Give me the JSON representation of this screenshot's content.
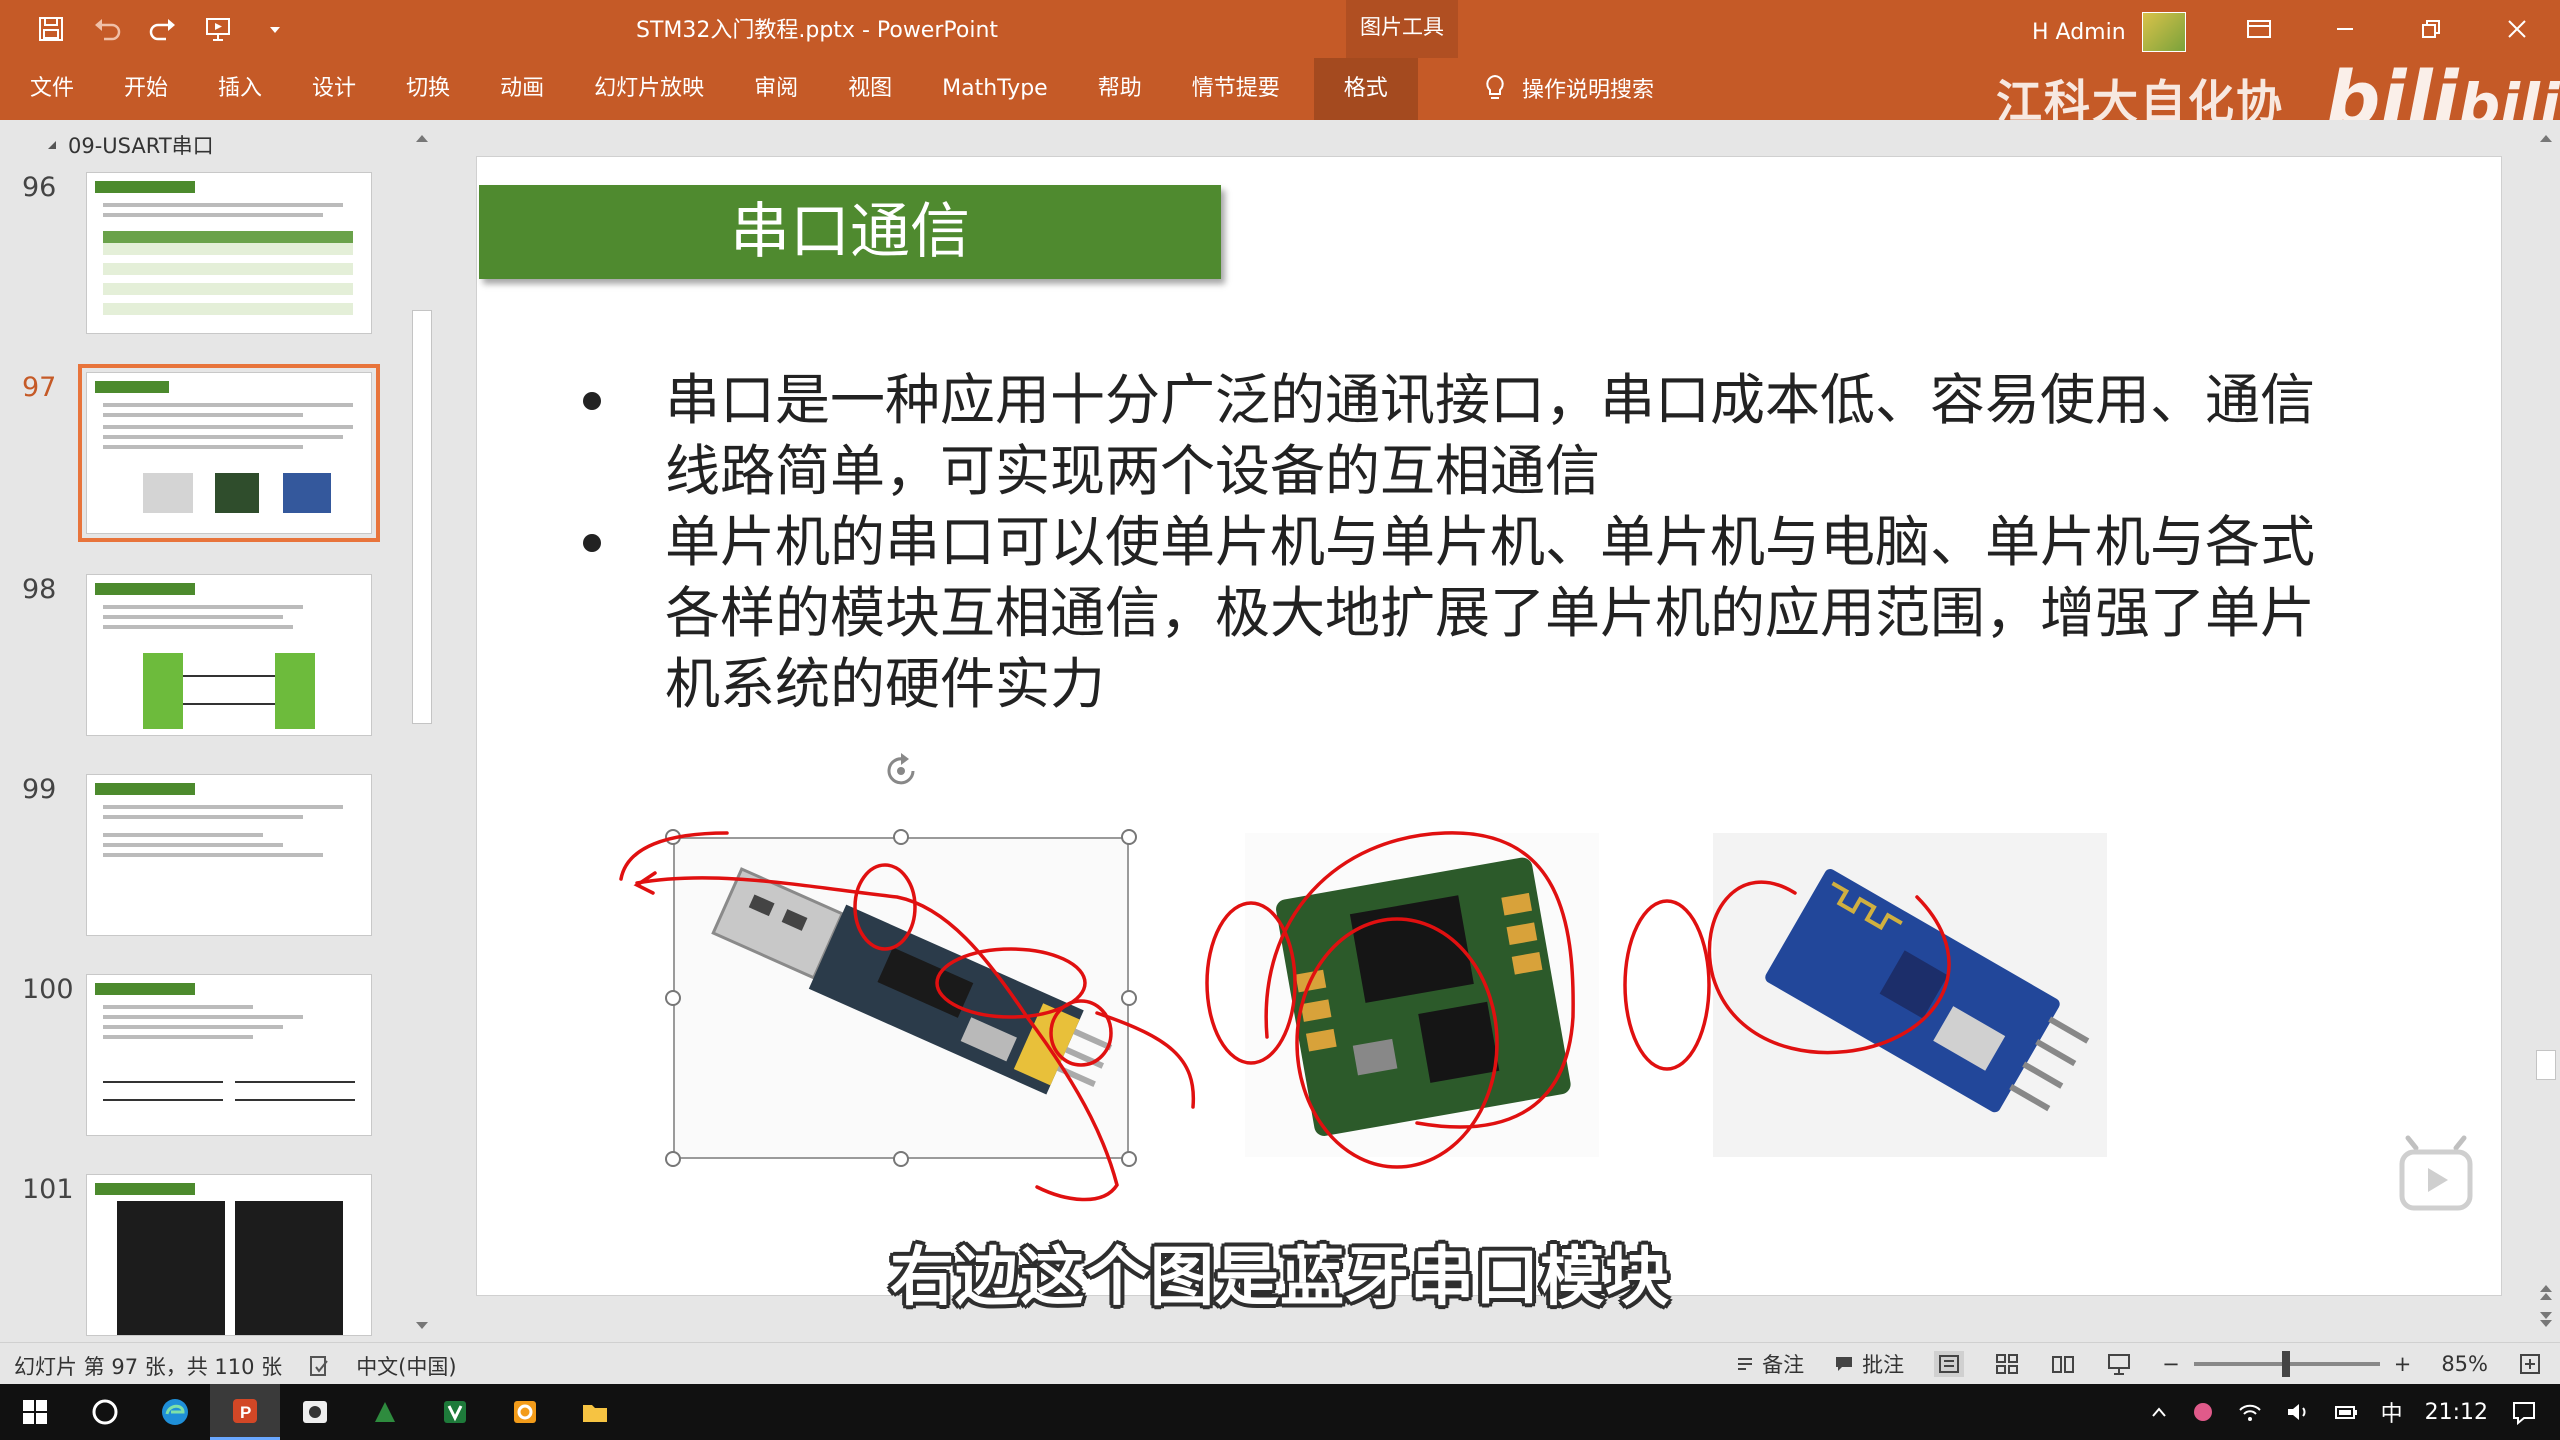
{
  "window": {
    "doc_title": "STM32入门教程.pptx  -  PowerPoint",
    "picture_tools": "图片工具",
    "user_name": "H Admin"
  },
  "ribbon": {
    "tabs": [
      "文件",
      "开始",
      "插入",
      "设计",
      "切换",
      "动画",
      "幻灯片放映",
      "审阅",
      "视图",
      "MathType",
      "帮助",
      "情节提要",
      "格式"
    ],
    "active_tab": "格式",
    "tell_me": "操作说明搜索"
  },
  "watermark": {
    "brand": "江科大自化协",
    "logo": "bilibili"
  },
  "thumbnails": {
    "section": "09-USART串口",
    "slides": [
      "96",
      "97",
      "98",
      "99",
      "100",
      "101"
    ],
    "selected": "97"
  },
  "slide": {
    "title": "串口通信",
    "bullets": [
      "串口是一种应用十分广泛的通讯接口，串口成本低、容易使用、通信线路简单，可实现两个设备的互相通信",
      "单片机的串口可以使单片机与单片机、单片机与电脑、单片机与各式各样的模块互相通信，极大地扩展了单片机的应用范围，增强了单片机系统的硬件实力"
    ],
    "images": [
      "usb-ttl-module",
      "serial-chip-module",
      "bluetooth-serial-module"
    ]
  },
  "subtitle": "右边这个图是蓝牙串口模块",
  "status": {
    "slide_info": "幻灯片 第 97 张，共 110 张",
    "language": "中文(中国)",
    "notes": "备注",
    "comments": "批注",
    "zoom": "85%"
  },
  "taskbar": {
    "ime": "中",
    "time": "21:12"
  },
  "colors": {
    "accent": "#c55a27",
    "title_green": "#4f8a2f",
    "annotation_red": "#e01010"
  }
}
